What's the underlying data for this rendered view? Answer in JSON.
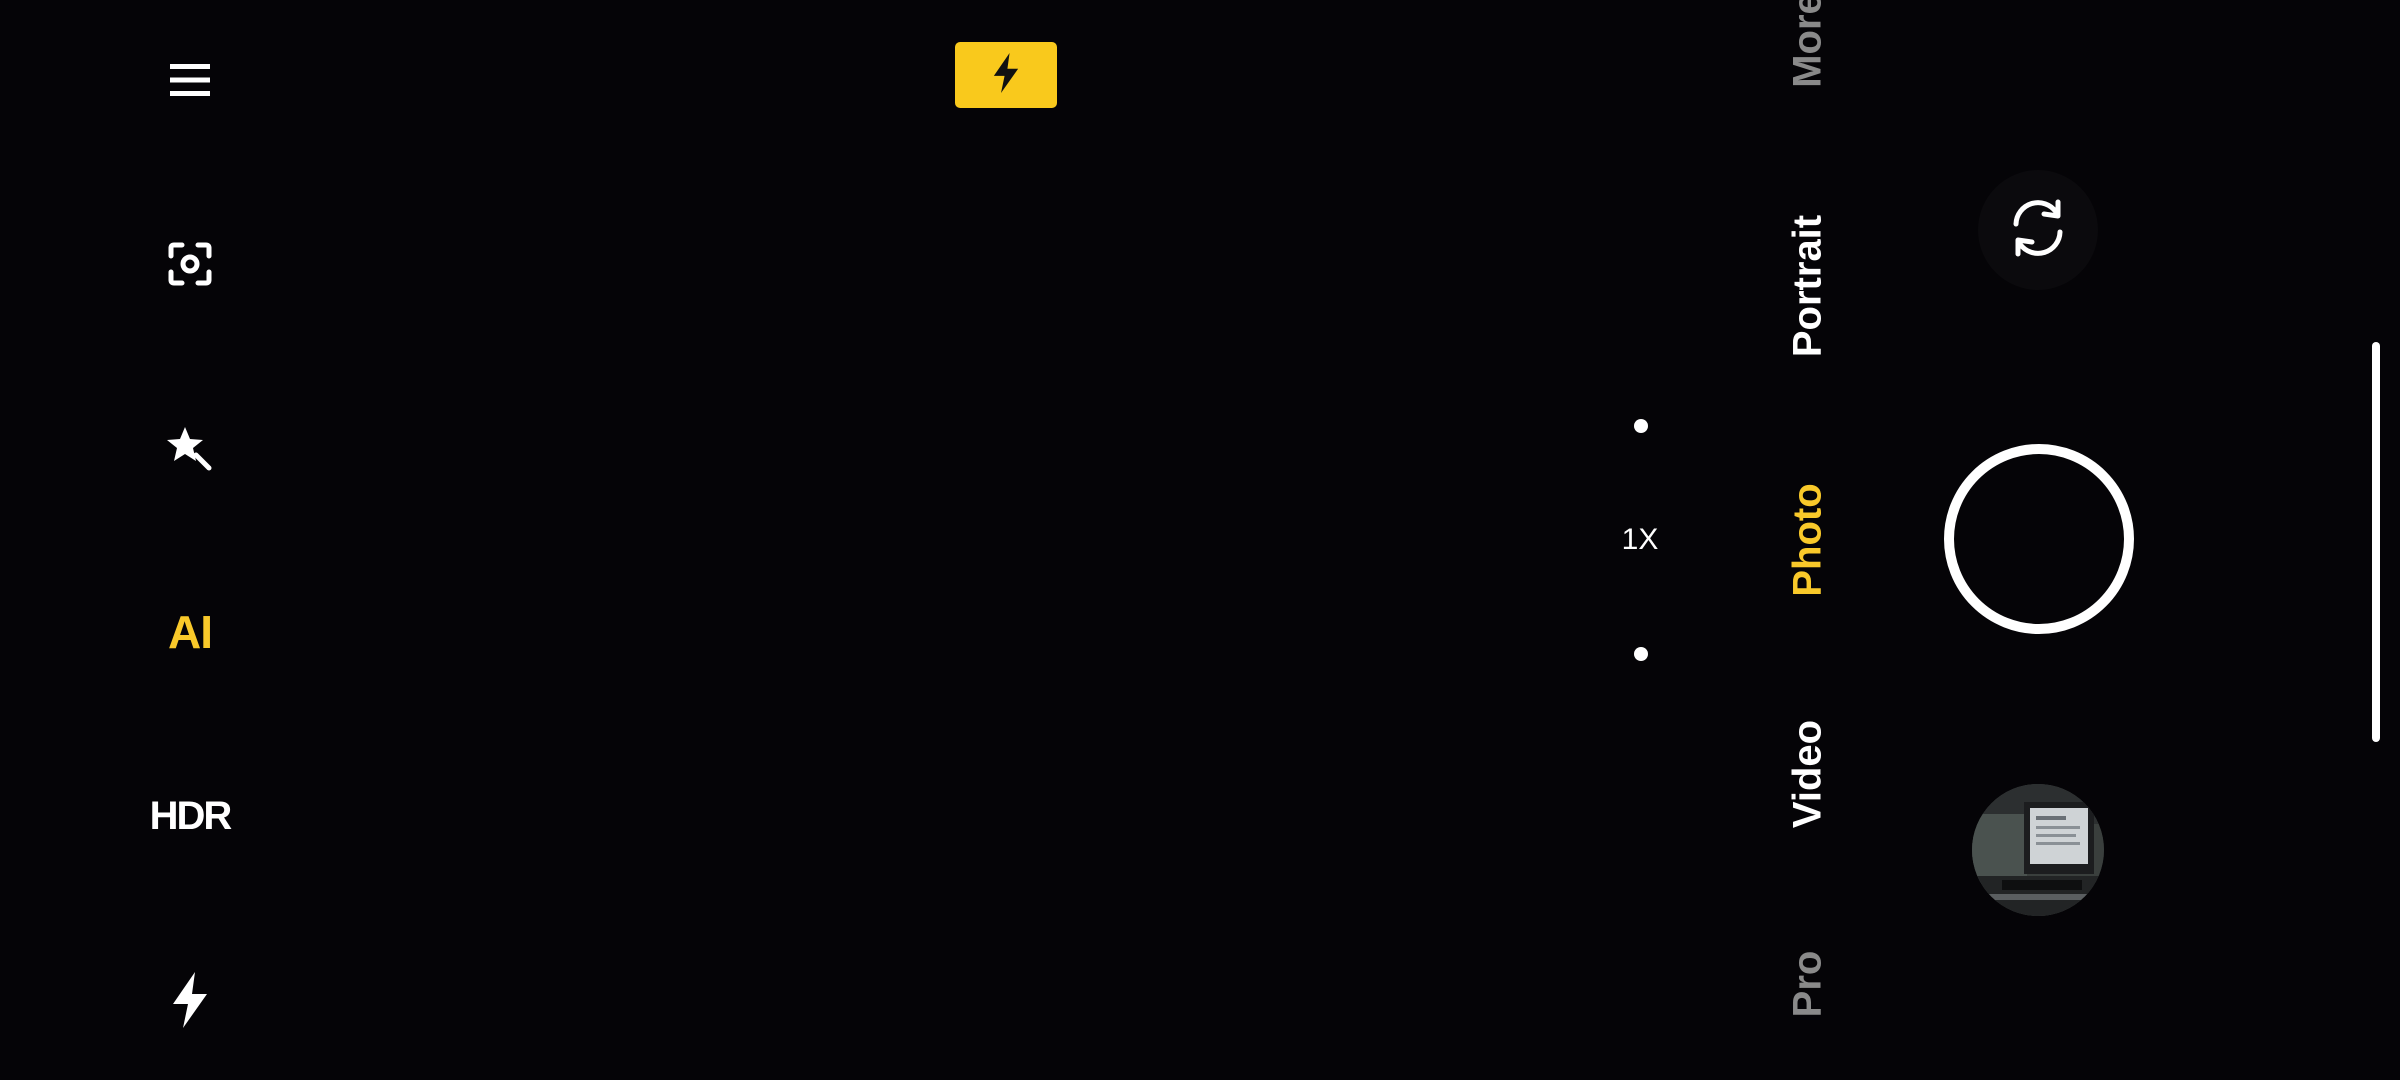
{
  "left_toolbar": {
    "menu_icon": "hamburger-menu-icon",
    "focus_icon": "focus-scan-icon",
    "beauty_icon": "magic-star-icon",
    "ai_label": "AI",
    "hdr_label": "HDR",
    "flash_icon": "flash-icon"
  },
  "top": {
    "flash_indicator_icon": "flash-icon"
  },
  "zoom": {
    "level": "1X"
  },
  "modes": {
    "items": [
      {
        "label": "More",
        "state": "dim"
      },
      {
        "label": "Portrait",
        "state": "normal"
      },
      {
        "label": "Photo",
        "state": "active"
      },
      {
        "label": "Video",
        "state": "normal"
      },
      {
        "label": "Pro",
        "state": "dim"
      }
    ]
  },
  "controls": {
    "switch_camera_icon": "switch-camera-icon",
    "shutter_icon": "shutter-button",
    "gallery_icon": "gallery-thumbnail"
  },
  "colors": {
    "accent": "#f9c92a",
    "background": "#040306",
    "text": "#ffffff",
    "dim_text": "#8a8a8a"
  }
}
